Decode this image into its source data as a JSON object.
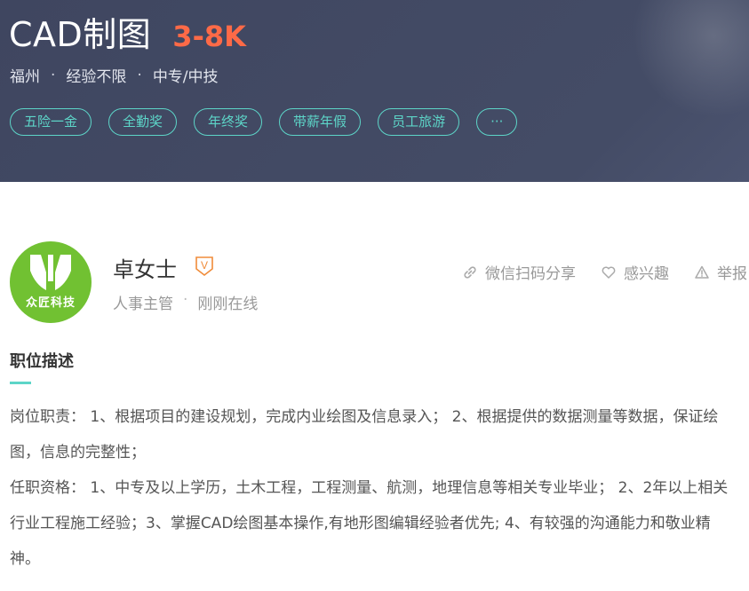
{
  "job": {
    "title": "CAD制图",
    "salary": "3-8K",
    "city": "福州",
    "experience": "经验不限",
    "education": "中专/中技",
    "separator": "·",
    "tags": [
      "五险一金",
      "全勤奖",
      "年终奖",
      "带薪年假",
      "员工旅游",
      "···"
    ]
  },
  "recruiter": {
    "company_logo_text": "众匠科技",
    "name": "卓女士",
    "badge_letter": "V",
    "position": "人事主管",
    "status": "刚刚在线",
    "separator": "·"
  },
  "actions": {
    "share_label": "微信扫码分享",
    "interest_label": "感兴趣",
    "report_label": "举报"
  },
  "description": {
    "section_title": "职位描述",
    "duty": "岗位职责： 1、根据项目的建设规划，完成内业绘图及信息录入； 2、根据提供的数据测量等数据，保证绘图，信息的完整性；",
    "requirement": "任职资格： 1、中专及以上学历，土木工程，工程测量、航测，地理信息等相关专业毕业； 2、2年以上相关行业工程施工经验；3、掌握CAD绘图基本操作,有地形图编辑经验者优先; 4、有较强的沟通能力和敬业精神。"
  },
  "colors": {
    "header_bg": "#444c66",
    "salary": "#fd6a47",
    "accent": "#5dd5c8",
    "avatar_bg": "#71c132",
    "badge": "#f08c3a"
  }
}
